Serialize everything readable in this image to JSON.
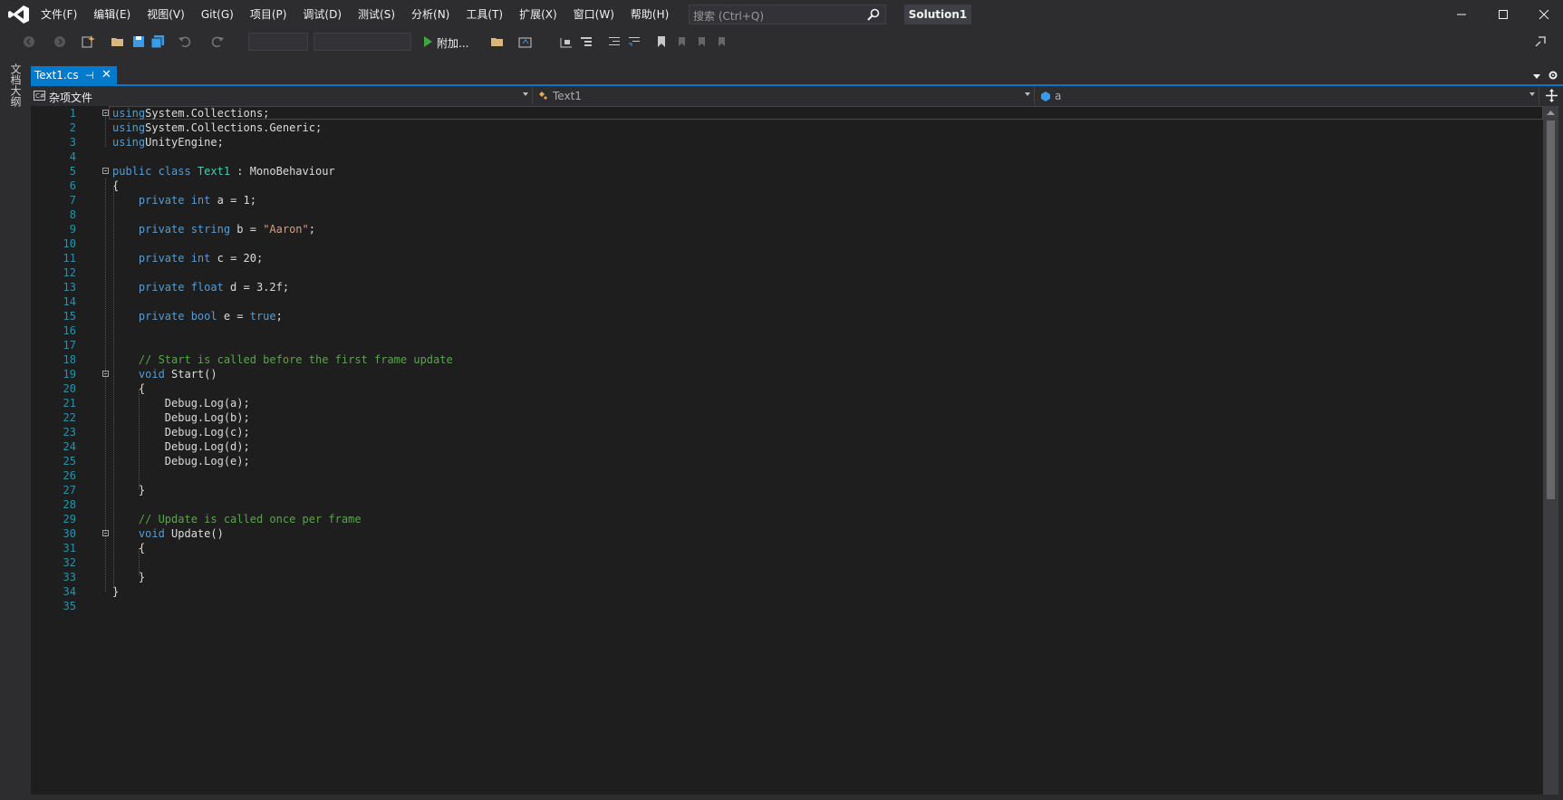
{
  "menu": [
    "文件(F)",
    "编辑(E)",
    "视图(V)",
    "Git(G)",
    "项目(P)",
    "调试(D)",
    "测试(S)",
    "分析(N)",
    "工具(T)",
    "扩展(X)",
    "窗口(W)",
    "帮助(H)"
  ],
  "search": {
    "placeholder": "搜索 (Ctrl+Q)"
  },
  "solution_name": "Solution1",
  "toolbar": {
    "attach_label": "附加..."
  },
  "side_tab": "文档大纲",
  "tab": {
    "label": "Text1.cs",
    "pin": "⊣",
    "close": "✕"
  },
  "navbar": {
    "project": "杂项文件",
    "type": "Text1",
    "member": "a"
  },
  "colors": {
    "accent": "#007acc",
    "keyword": "#569cd6",
    "type": "#4ec9b0",
    "string": "#d69d85",
    "comment": "#57a64a",
    "line_number": "#2b91af"
  },
  "code_lines": [
    [
      [
        "kw",
        "using"
      ],
      [
        "",
        "System.Collections;"
      ]
    ],
    [
      [
        "kw",
        "using"
      ],
      [
        "",
        "System.Collections.Generic;"
      ]
    ],
    [
      [
        "kw",
        "using"
      ],
      [
        "",
        "UnityEngine;"
      ]
    ],
    [],
    [
      [
        "kw",
        "public class "
      ],
      [
        "ty",
        "Text1"
      ],
      [
        "",
        " : MonoBehaviour"
      ]
    ],
    [
      [
        "",
        "{"
      ]
    ],
    [
      [
        "",
        "    "
      ],
      [
        "kw",
        "private int"
      ],
      [
        "",
        " a = 1;"
      ]
    ],
    [],
    [
      [
        "",
        "    "
      ],
      [
        "kw",
        "private string"
      ],
      [
        "",
        " b = "
      ],
      [
        "str",
        "\"Aaron\""
      ],
      [
        "",
        ";"
      ]
    ],
    [],
    [
      [
        "",
        "    "
      ],
      [
        "kw",
        "private int"
      ],
      [
        "",
        " c = 20;"
      ]
    ],
    [],
    [
      [
        "",
        "    "
      ],
      [
        "kw",
        "private float"
      ],
      [
        "",
        " d = 3.2f;"
      ]
    ],
    [],
    [
      [
        "",
        "    "
      ],
      [
        "kw",
        "private bool"
      ],
      [
        "",
        " e = "
      ],
      [
        "kw",
        "true"
      ],
      [
        "",
        ";"
      ]
    ],
    [],
    [],
    [
      [
        "",
        "    "
      ],
      [
        "cm",
        "// Start is called before the first frame update"
      ]
    ],
    [
      [
        "",
        "    "
      ],
      [
        "kw",
        "void"
      ],
      [
        "",
        " Start()"
      ]
    ],
    [
      [
        "",
        "    {"
      ]
    ],
    [
      [
        "",
        "        Debug.Log(a);"
      ]
    ],
    [
      [
        "",
        "        Debug.Log(b);"
      ]
    ],
    [
      [
        "",
        "        Debug.Log(c);"
      ]
    ],
    [
      [
        "",
        "        Debug.Log(d);"
      ]
    ],
    [
      [
        "",
        "        Debug.Log(e);"
      ]
    ],
    [],
    [
      [
        "",
        "    }"
      ]
    ],
    [],
    [
      [
        "",
        "    "
      ],
      [
        "cm",
        "// Update is called once per frame"
      ]
    ],
    [
      [
        "",
        "    "
      ],
      [
        "kw",
        "void"
      ],
      [
        "",
        " Update()"
      ]
    ],
    [
      [
        "",
        "    {"
      ]
    ],
    [],
    [
      [
        "",
        "    }"
      ]
    ],
    [
      [
        "",
        "}"
      ]
    ],
    []
  ]
}
